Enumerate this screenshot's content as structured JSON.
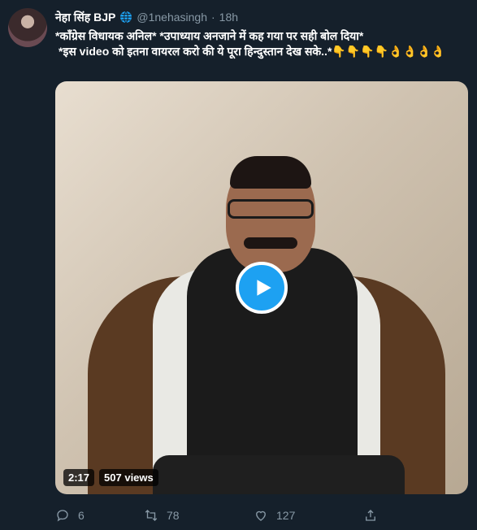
{
  "tweet": {
    "display_name": "नेहा सिंह BJP",
    "handle": "@1nehasingh",
    "separator": "·",
    "time": "18h",
    "text_line1": "*कॉंग्रेस विधायक अनिल* *उपाध्याय अनजाने में कह गया पर सही बोल दिया*",
    "text_line2": "*इस video को इतना वायरल करो की ये पूरा हिन्दुस्तान देख सके..*",
    "emojis": "👇👇👇👇👌👌👌👌"
  },
  "media": {
    "duration": "2:17",
    "views": "507 views"
  },
  "actions": {
    "replies": "6",
    "retweets": "78",
    "likes": "127"
  },
  "colors": {
    "background": "#15202b",
    "muted": "#8899a6",
    "accent": "#1da1f2"
  },
  "icons": [
    "globe-icon",
    "play-icon",
    "reply-icon",
    "retweet-icon",
    "like-icon",
    "share-icon"
  ]
}
